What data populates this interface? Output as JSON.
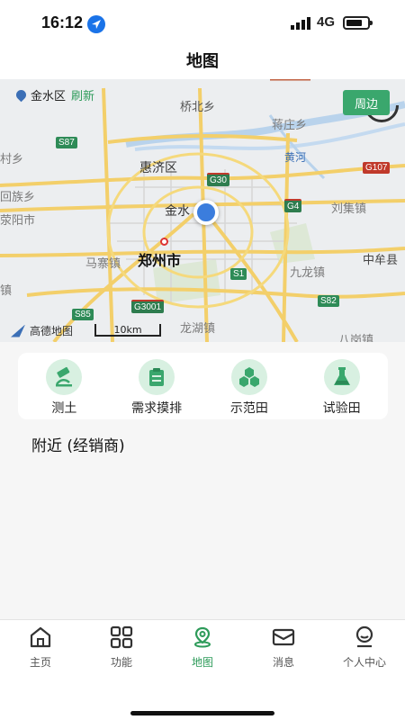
{
  "status_bar": {
    "time": "16:12",
    "network": "4G",
    "icons": [
      "location-arrow-icon",
      "signal-icon",
      "battery-icon"
    ]
  },
  "header": {
    "title": "地图"
  },
  "map": {
    "current_district": "金水区",
    "refresh_label": "刷新",
    "nearby_button": "周边",
    "attribution": "高德地图",
    "scale_label": "10km",
    "place_labels": {
      "qiaobei": "桥北乡",
      "jiangzhuang": "蒋庄乡",
      "huanghe": "黄河",
      "cun": "村乡",
      "huiji": "惠济区",
      "huizu": "回族乡",
      "liuji": "刘集镇",
      "yangshi": "荥阳市",
      "jinshui": "金水",
      "zhengzhou": "郑州市",
      "mazhai": "马寨镇",
      "jiulong": "九龙镇",
      "zhongmou": "中牟县",
      "zhen": "镇",
      "longhu": "龙湖镇",
      "bagang": "八岗镇"
    },
    "road_badges": {
      "s87": "S87",
      "g30": "G30",
      "g107": "G107",
      "g4": "G4",
      "s1": "S1",
      "s82": "S82",
      "s85": "S85",
      "g3001": "G3001"
    }
  },
  "quick_actions": [
    {
      "label": "测土",
      "icon": "microscope-icon"
    },
    {
      "label": "需求摸排",
      "icon": "clipboard-icon"
    },
    {
      "label": "示范田",
      "icon": "hexagon-field-icon"
    },
    {
      "label": "试验田",
      "icon": "flask-icon"
    }
  ],
  "nearby": {
    "title": "附近 (经销商)"
  },
  "tab_bar": {
    "active": "地图",
    "tabs": [
      {
        "label": "主页",
        "icon": "home-icon"
      },
      {
        "label": "功能",
        "icon": "grid-icon"
      },
      {
        "label": "地图",
        "icon": "map-pin-icon"
      },
      {
        "label": "消息",
        "icon": "mail-icon"
      },
      {
        "label": "个人中心",
        "icon": "user-icon"
      }
    ]
  },
  "colors": {
    "accent_green": "#3aa76d",
    "active_tab": "#2e9b5a",
    "location_blue": "#3b7ddd",
    "icon_circle": "#d8f0e1"
  }
}
